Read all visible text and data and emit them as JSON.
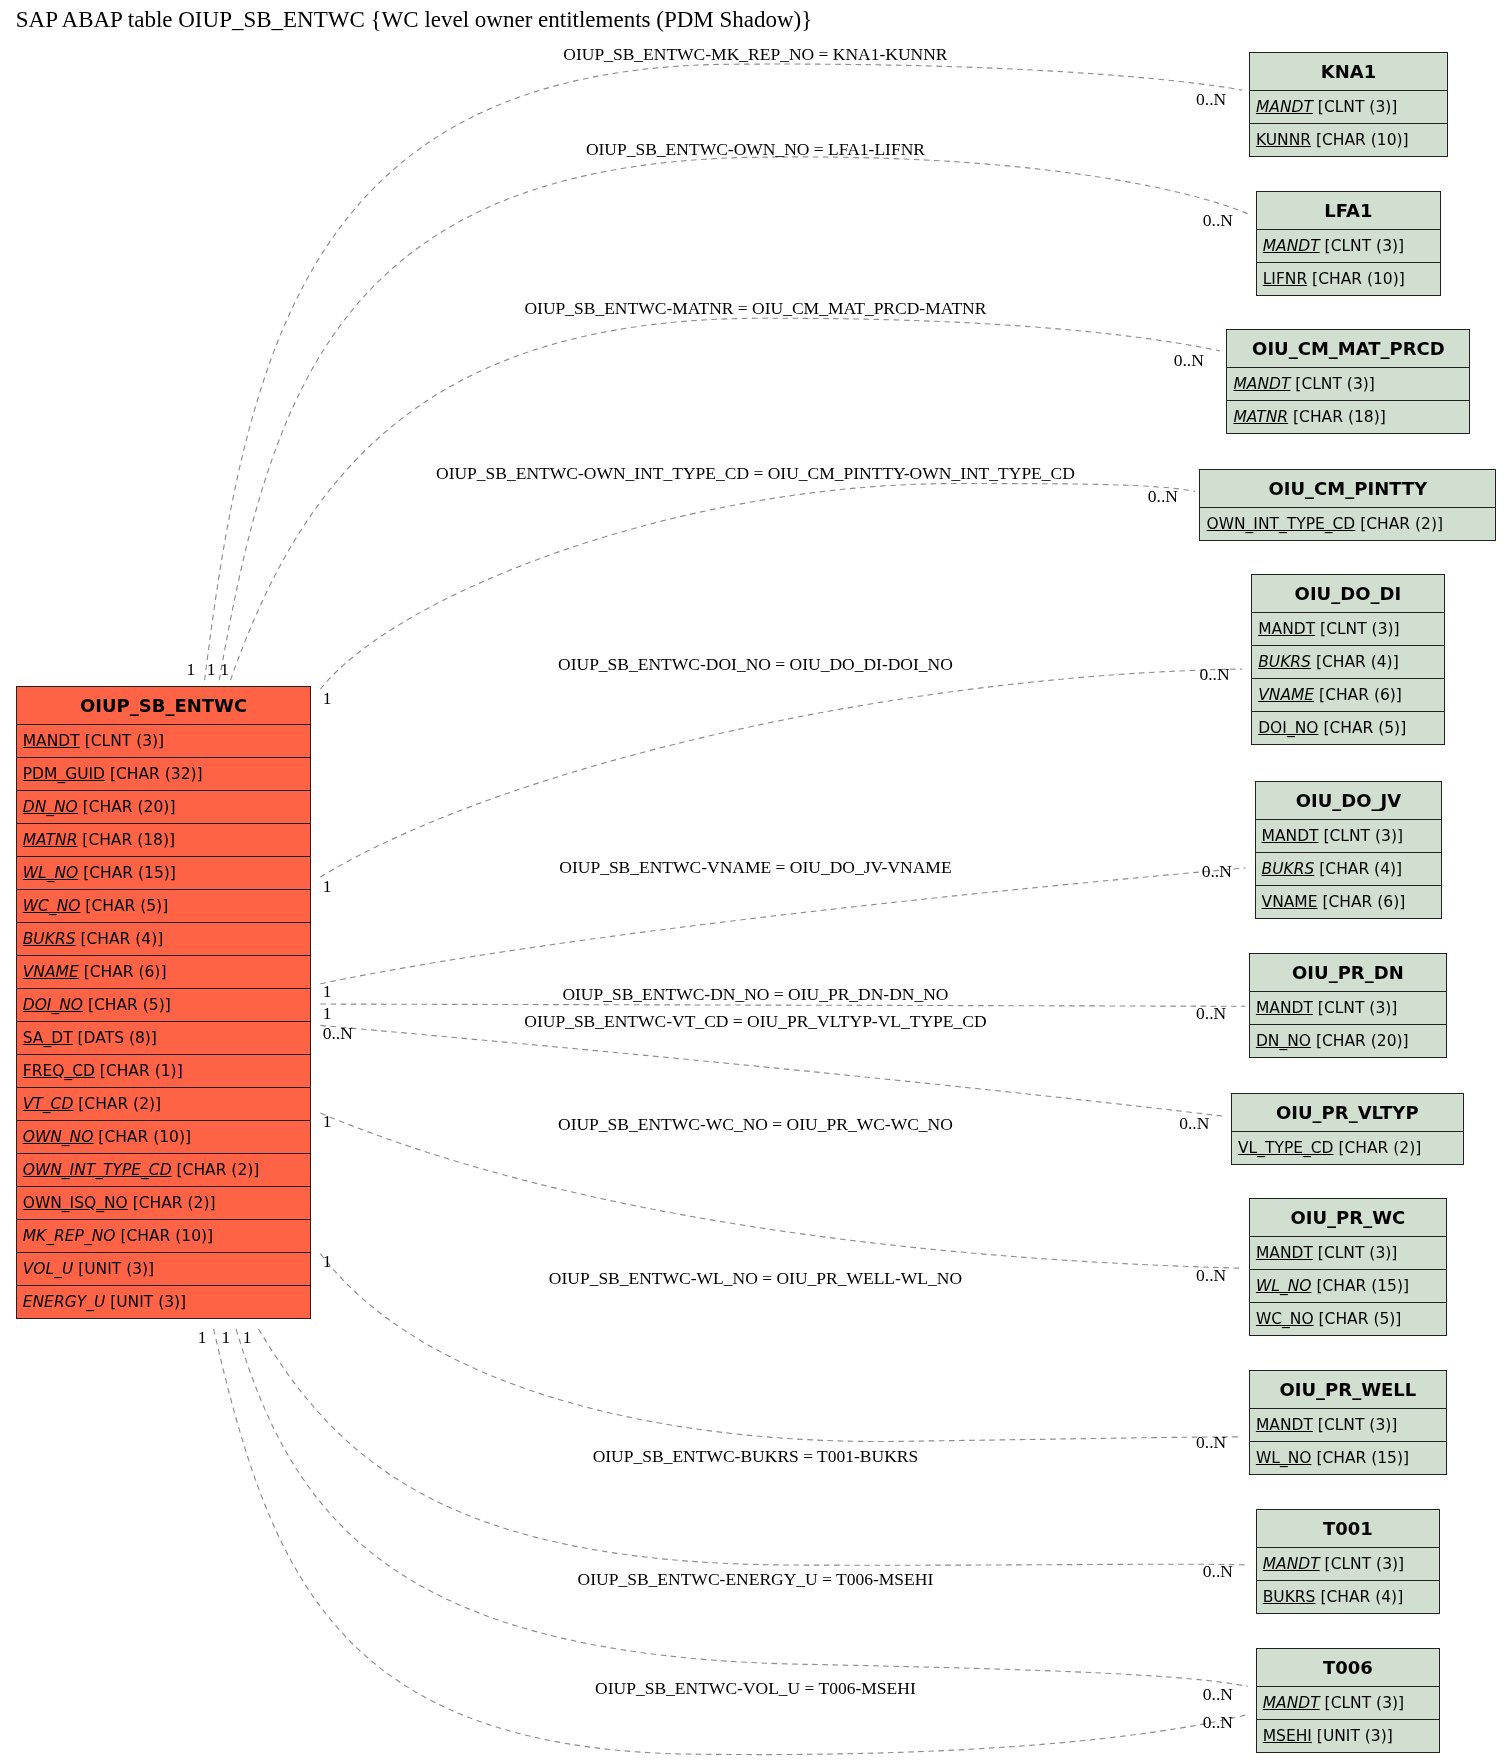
{
  "title": "SAP ABAP table OIUP_SB_ENTWC {WC level owner entitlements (PDM Shadow)}",
  "tables": [
    {
      "name": "OIUP_SB_ENTWC",
      "kind": "main",
      "fields": [
        {
          "name": "MANDT",
          "type": "[CLNT (3)]",
          "key": true,
          "foreign": false
        },
        {
          "name": "PDM_GUID",
          "type": "[CHAR (32)]",
          "key": true,
          "foreign": false
        },
        {
          "name": "DN_NO",
          "type": "[CHAR (20)]",
          "key": true,
          "foreign": true
        },
        {
          "name": "MATNR",
          "type": "[CHAR (18)]",
          "key": true,
          "foreign": true
        },
        {
          "name": "WL_NO",
          "type": "[CHAR (15)]",
          "key": true,
          "foreign": true
        },
        {
          "name": "WC_NO",
          "type": "[CHAR (5)]",
          "key": true,
          "foreign": true
        },
        {
          "name": "BUKRS",
          "type": "[CHAR (4)]",
          "key": true,
          "foreign": true
        },
        {
          "name": "VNAME",
          "type": "[CHAR (6)]",
          "key": true,
          "foreign": true
        },
        {
          "name": "DOI_NO",
          "type": "[CHAR (5)]",
          "key": true,
          "foreign": true
        },
        {
          "name": "SA_DT",
          "type": "[DATS (8)]",
          "key": true,
          "foreign": false
        },
        {
          "name": "FREQ_CD",
          "type": "[CHAR (1)]",
          "key": true,
          "foreign": false
        },
        {
          "name": "VT_CD",
          "type": "[CHAR (2)]",
          "key": true,
          "foreign": true
        },
        {
          "name": "OWN_NO",
          "type": "[CHAR (10)]",
          "key": true,
          "foreign": true
        },
        {
          "name": "OWN_INT_TYPE_CD",
          "type": "[CHAR (2)]",
          "key": true,
          "foreign": true
        },
        {
          "name": "OWN_ISQ_NO",
          "type": "[CHAR (2)]",
          "key": true,
          "foreign": false
        },
        {
          "name": "MK_REP_NO",
          "type": "[CHAR (10)]",
          "key": false,
          "foreign": true
        },
        {
          "name": "VOL_U",
          "type": "[UNIT (3)]",
          "key": false,
          "foreign": true
        },
        {
          "name": "ENERGY_U",
          "type": "[UNIT (3)]",
          "key": false,
          "foreign": true
        }
      ]
    },
    {
      "name": "KNA1",
      "kind": "related",
      "fields": [
        {
          "name": "MANDT",
          "type": "[CLNT (3)]",
          "key": true,
          "foreign": true
        },
        {
          "name": "KUNNR",
          "type": "[CHAR (10)]",
          "key": true,
          "foreign": false
        }
      ]
    },
    {
      "name": "LFA1",
      "kind": "related",
      "fields": [
        {
          "name": "MANDT",
          "type": "[CLNT (3)]",
          "key": true,
          "foreign": true
        },
        {
          "name": "LIFNR",
          "type": "[CHAR (10)]",
          "key": true,
          "foreign": false
        }
      ]
    },
    {
      "name": "OIU_CM_MAT_PRCD",
      "kind": "related",
      "fields": [
        {
          "name": "MANDT",
          "type": "[CLNT (3)]",
          "key": true,
          "foreign": true
        },
        {
          "name": "MATNR",
          "type": "[CHAR (18)]",
          "key": true,
          "foreign": true
        }
      ]
    },
    {
      "name": "OIU_CM_PINTTY",
      "kind": "related",
      "fields": [
        {
          "name": "OWN_INT_TYPE_CD",
          "type": "[CHAR (2)]",
          "key": true,
          "foreign": false
        }
      ]
    },
    {
      "name": "OIU_DO_DI",
      "kind": "related",
      "fields": [
        {
          "name": "MANDT",
          "type": "[CLNT (3)]",
          "key": true,
          "foreign": false
        },
        {
          "name": "BUKRS",
          "type": "[CHAR (4)]",
          "key": true,
          "foreign": true
        },
        {
          "name": "VNAME",
          "type": "[CHAR (6)]",
          "key": true,
          "foreign": true
        },
        {
          "name": "DOI_NO",
          "type": "[CHAR (5)]",
          "key": true,
          "foreign": false
        }
      ]
    },
    {
      "name": "OIU_DO_JV",
      "kind": "related",
      "fields": [
        {
          "name": "MANDT",
          "type": "[CLNT (3)]",
          "key": true,
          "foreign": false
        },
        {
          "name": "BUKRS",
          "type": "[CHAR (4)]",
          "key": true,
          "foreign": true
        },
        {
          "name": "VNAME",
          "type": "[CHAR (6)]",
          "key": true,
          "foreign": false
        }
      ]
    },
    {
      "name": "OIU_PR_DN",
      "kind": "related",
      "fields": [
        {
          "name": "MANDT",
          "type": "[CLNT (3)]",
          "key": true,
          "foreign": false
        },
        {
          "name": "DN_NO",
          "type": "[CHAR (20)]",
          "key": true,
          "foreign": false
        }
      ]
    },
    {
      "name": "OIU_PR_VLTYP",
      "kind": "related",
      "fields": [
        {
          "name": "VL_TYPE_CD",
          "type": "[CHAR (2)]",
          "key": true,
          "foreign": false
        }
      ]
    },
    {
      "name": "OIU_PR_WC",
      "kind": "related",
      "fields": [
        {
          "name": "MANDT",
          "type": "[CLNT (3)]",
          "key": true,
          "foreign": false
        },
        {
          "name": "WL_NO",
          "type": "[CHAR (15)]",
          "key": true,
          "foreign": true
        },
        {
          "name": "WC_NO",
          "type": "[CHAR (5)]",
          "key": true,
          "foreign": false
        }
      ]
    },
    {
      "name": "OIU_PR_WELL",
      "kind": "related",
      "fields": [
        {
          "name": "MANDT",
          "type": "[CLNT (3)]",
          "key": true,
          "foreign": false
        },
        {
          "name": "WL_NO",
          "type": "[CHAR (15)]",
          "key": true,
          "foreign": false
        }
      ]
    },
    {
      "name": "T001",
      "kind": "related",
      "fields": [
        {
          "name": "MANDT",
          "type": "[CLNT (3)]",
          "key": true,
          "foreign": true
        },
        {
          "name": "BUKRS",
          "type": "[CHAR (4)]",
          "key": true,
          "foreign": false
        }
      ]
    },
    {
      "name": "T006",
      "kind": "related",
      "fields": [
        {
          "name": "MANDT",
          "type": "[CLNT (3)]",
          "key": true,
          "foreign": true
        },
        {
          "name": "MSEHI",
          "type": "[UNIT (3)]",
          "key": true,
          "foreign": false
        }
      ]
    }
  ],
  "relations": [
    {
      "label": "OIUP_SB_ENTWC-MK_REP_NO = KNA1-KUNNR",
      "source_card": "1",
      "target_card": "0..N"
    },
    {
      "label": "OIUP_SB_ENTWC-OWN_NO = LFA1-LIFNR",
      "source_card": "1",
      "target_card": "0..N"
    },
    {
      "label": "OIUP_SB_ENTWC-MATNR = OIU_CM_MAT_PRCD-MATNR",
      "source_card": "1",
      "target_card": "0..N"
    },
    {
      "label": "OIUP_SB_ENTWC-OWN_INT_TYPE_CD = OIU_CM_PINTTY-OWN_INT_TYPE_CD",
      "source_card": "1",
      "target_card": "0..N"
    },
    {
      "label": "OIUP_SB_ENTWC-DOI_NO = OIU_DO_DI-DOI_NO",
      "source_card": "1",
      "target_card": "0..N"
    },
    {
      "label": "OIUP_SB_ENTWC-VNAME = OIU_DO_JV-VNAME",
      "source_card": "1",
      "target_card": "0..N"
    },
    {
      "label": "OIUP_SB_ENTWC-DN_NO = OIU_PR_DN-DN_NO",
      "source_card": "1",
      "target_card": "0..N"
    },
    {
      "label": "OIUP_SB_ENTWC-VT_CD = OIU_PR_VLTYP-VL_TYPE_CD",
      "source_card": "0..N",
      "target_card": "0..N"
    },
    {
      "label": "OIUP_SB_ENTWC-WC_NO = OIU_PR_WC-WC_NO",
      "source_card": "1",
      "target_card": "0..N"
    },
    {
      "label": "OIUP_SB_ENTWC-WL_NO = OIU_PR_WELL-WL_NO",
      "source_card": "1",
      "target_card": "0..N"
    },
    {
      "label": "OIUP_SB_ENTWC-BUKRS = T001-BUKRS",
      "source_card": "1",
      "target_card": "0..N"
    },
    {
      "label": "OIUP_SB_ENTWC-ENERGY_U = T006-MSEHI",
      "source_card": "1",
      "target_card": "0..N"
    },
    {
      "label": "OIUP_SB_ENTWC-VOL_U = T006-MSEHI",
      "source_card": "1",
      "target_card": "0..N"
    }
  ]
}
